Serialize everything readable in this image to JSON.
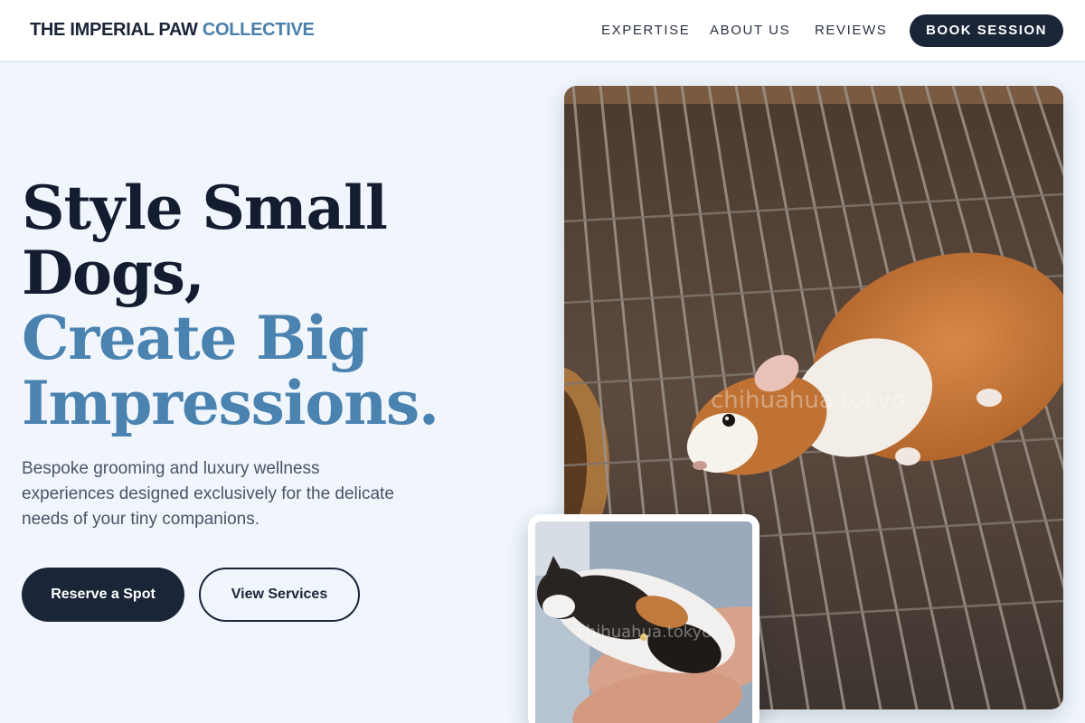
{
  "header": {
    "brand_main": "THE IMPERIAL PAW",
    "brand_accent": "COLLECTIVE",
    "nav": {
      "expertise": "EXPERTISE",
      "about": "ABOUT US",
      "reviews": "REVIEWS"
    },
    "cta": "BOOK SESSION"
  },
  "hero": {
    "headline_line1": "Style Small",
    "headline_line2": "Dogs,",
    "headline_line3": "Create Big",
    "headline_line4": "Impressions.",
    "subtext": "Bespoke grooming and luxury wellness experiences designed exclusively for the delicate needs of your tiny companions.",
    "primary_button": "Reserve a Spot",
    "secondary_button": "View Services"
  },
  "images": {
    "main_watermark": "chihuahua.tokyo",
    "inset_watermark": "chihuahua.tokyo"
  },
  "colors": {
    "navy": "#1b2538",
    "accent_blue": "#4a82b0",
    "background": "#f0f6fc"
  }
}
